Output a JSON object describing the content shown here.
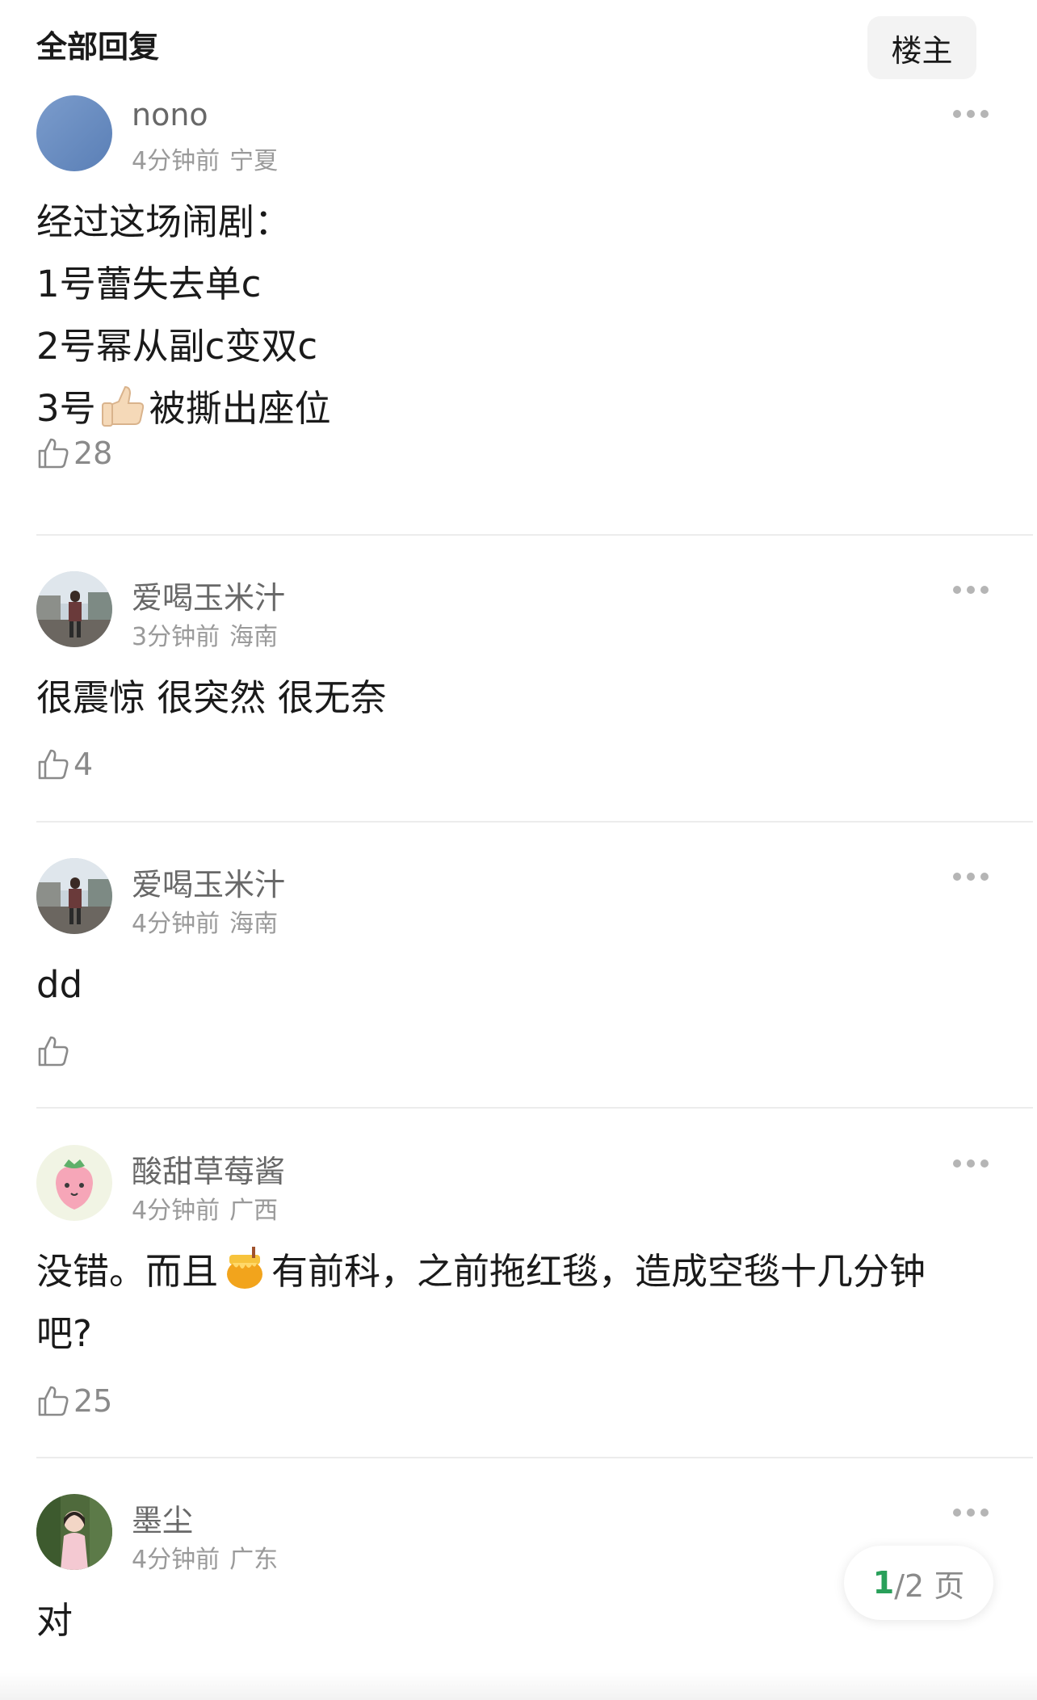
{
  "header": {
    "title": "全部回复",
    "owner_button": "楼主"
  },
  "comments": [
    {
      "username": "nono",
      "time": "4分钟前",
      "location": "宁夏",
      "avatar": "blue-gradient-avatar",
      "lines": [
        "经过这场闹剧：",
        "1号蕾失去单c",
        "2号幂从副c变双c",
        "3号",
        "被撕出座位"
      ],
      "emoji": "thumbs-up-emoji",
      "likes": "28"
    },
    {
      "username": "爱喝玉米汁",
      "time": "3分钟前",
      "location": "海南",
      "avatar": "street-photo-avatar",
      "lines": [
        "很震惊 很突然 很无奈"
      ],
      "likes": "4"
    },
    {
      "username": "爱喝玉米汁",
      "time": "4分钟前",
      "location": "海南",
      "avatar": "street-photo-avatar",
      "lines": [
        "dd"
      ],
      "likes": ""
    },
    {
      "username": "酸甜草莓酱",
      "time": "4分钟前",
      "location": "广西",
      "avatar": "strawberry-avatar",
      "lines": [
        "没错。而且",
        "有前科，之前拖红毯，造成空毯十几分钟",
        "吧?"
      ],
      "emoji": "honey-pot-emoji",
      "likes": "25"
    },
    {
      "username": "墨尘",
      "time": "4分钟前",
      "location": "广东",
      "avatar": "girl-photo-avatar",
      "lines": [
        "对"
      ]
    }
  ],
  "pager": {
    "current": "1",
    "total": "/2 页"
  },
  "colors": {
    "accent_green": "#29a05a",
    "username_gray": "#686868",
    "meta_gray": "#9a9a9a"
  }
}
